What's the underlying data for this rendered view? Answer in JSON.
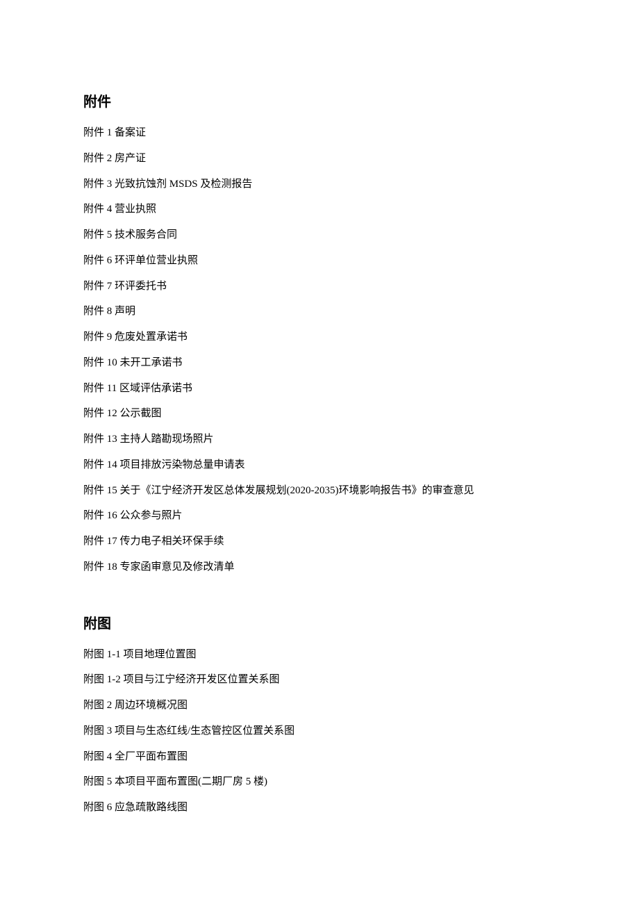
{
  "sections": [
    {
      "heading": "附件",
      "items": [
        "附件 1 备案证",
        "附件 2 房产证",
        "附件 3 光致抗蚀剂 MSDS 及检测报告",
        "附件 4 营业执照",
        "附件 5 技术服务合同",
        "附件 6 环评单位营业执照",
        "附件 7 环评委托书",
        "附件 8 声明",
        "附件 9 危废处置承诺书",
        "附件 10 未开工承诺书",
        "附件 11 区域评估承诺书",
        "附件 12 公示截图",
        "附件 13 主持人踏勘现场照片",
        "附件 14 项目排放污染物总量申请表",
        "附件 15 关于《江宁经济开发区总体发展规划(2020-2035)环境影响报告书》的审查意见",
        "附件 16 公众参与照片",
        "附件 17 传力电子相关环保手续",
        "附件 18 专家函审意见及修改清单"
      ]
    },
    {
      "heading": "附图",
      "items": [
        "附图 1‑1 项目地理位置图",
        "附图 1‑2 项目与江宁经济开发区位置关系图",
        "附图 2 周边环境概况图",
        "附图 3 项目与生态红线/生态管控区位置关系图",
        "附图 4 全厂平面布置图",
        "附图 5 本项目平面布置图(二期厂房 5 楼)",
        "附图 6 应急疏散路线图"
      ]
    }
  ]
}
